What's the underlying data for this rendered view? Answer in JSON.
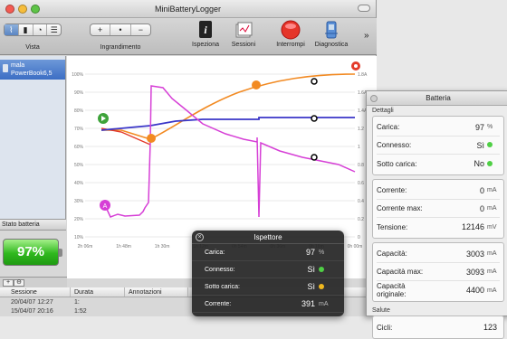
{
  "window": {
    "title": "MiniBatteryLogger"
  },
  "toolbar": {
    "vista_label": "Vista",
    "ingrandimento_label": "Ingrandimento",
    "zoom_buttons": [
      "+",
      "•",
      "−"
    ],
    "ispeziona_label": "Ispeziona",
    "sessioni_label": "Sessioni",
    "interrompi_label": "Interrompi",
    "diagnostica_label": "Diagnostica",
    "overflow": "»"
  },
  "sidebar": {
    "item_name": "mala",
    "item_model": "PowerBook6,5"
  },
  "status": {
    "label": "Stato batteria",
    "percent": "97%"
  },
  "bottombar": {
    "add": "+",
    "remove": "⊖"
  },
  "table": {
    "headers": [
      "Sessione",
      "Durata",
      "Annotazioni"
    ],
    "rows": [
      [
        "20/04/07 12:27",
        "1:",
        ""
      ],
      [
        "15/04/07 20:16",
        "1:52",
        ""
      ]
    ]
  },
  "chart_data": {
    "type": "line",
    "y_ticks": [
      "100%",
      "90%",
      "80%",
      "70%",
      "60%",
      "50%",
      "40%",
      "30%",
      "20%",
      "10%"
    ],
    "y_right_ticks": [
      "1.8A",
      "1.6A",
      "1.4A",
      "1.2",
      "1",
      "0.8",
      "0.6",
      "0.4",
      "0.2",
      "0"
    ],
    "x_ticks": [
      "2h 06m",
      "1h 48m",
      "1h 30m",
      "1h 12m",
      "0h 54m",
      "0h 36m",
      "0h 18m",
      "0h 00m"
    ],
    "ylim": [
      0,
      100
    ],
    "colors": {
      "charge": "#3a36c8",
      "orange": "#f28a22",
      "magenta": "#d63fd6",
      "red": "#e33a2a"
    }
  },
  "battery_panel": {
    "title": "Batteria",
    "section_details": "Dettagli",
    "rows1": [
      {
        "k": "Carica:",
        "v": "97",
        "u": "%"
      },
      {
        "k": "Connesso:",
        "v": "Sì",
        "u": "",
        "dot": "#4fcf45"
      },
      {
        "k": "Sotto carica:",
        "v": "No",
        "u": "",
        "dot": "#4fcf45"
      }
    ],
    "rows2": [
      {
        "k": "Corrente:",
        "v": "0",
        "u": "mA"
      },
      {
        "k": "Corrente max:",
        "v": "0",
        "u": "mA"
      },
      {
        "k": "Tensione:",
        "v": "12146",
        "u": "mV"
      }
    ],
    "rows3": [
      {
        "k": "Capacità:",
        "v": "3003",
        "u": "mA"
      },
      {
        "k": "Capacità max:",
        "v": "3093",
        "u": "mA"
      },
      {
        "k": "Capacità originale:",
        "v": "4400",
        "u": "mA"
      }
    ],
    "section_health": "Salute",
    "health_row": {
      "k": "Cicli:",
      "v": "123"
    }
  },
  "inspector": {
    "title": "Ispettore",
    "close": "×",
    "rows": [
      {
        "k": "Carica:",
        "v": "97",
        "u": "%"
      },
      {
        "k": "Connesso:",
        "v": "Sì",
        "u": "",
        "dot": "#4fcf45"
      },
      {
        "k": "Sotto carica:",
        "v": "Sì",
        "u": "",
        "dot": "#f0b81e"
      },
      {
        "k": "Corrente:",
        "v": "391",
        "u": "mA"
      }
    ]
  }
}
